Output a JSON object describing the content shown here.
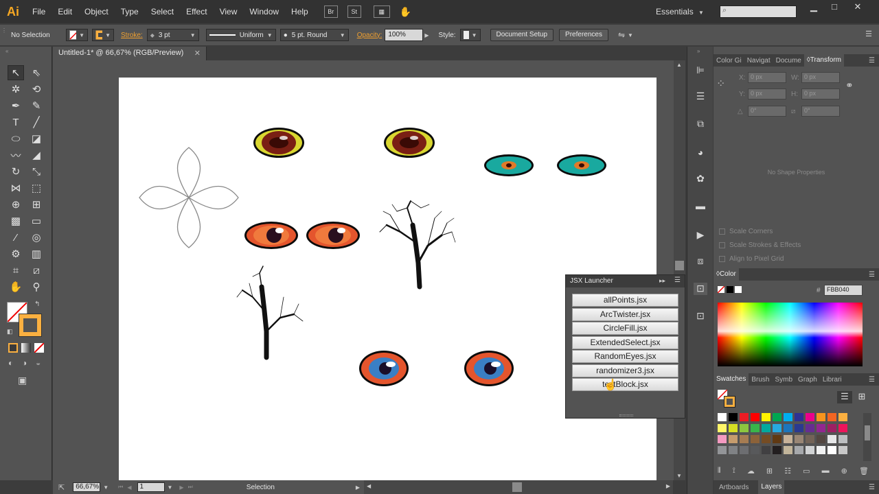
{
  "app": {
    "logo": "Ai"
  },
  "menu": [
    "File",
    "Edit",
    "Object",
    "Type",
    "Select",
    "Effect",
    "View",
    "Window",
    "Help"
  ],
  "menu_buttons": [
    "Br",
    "St"
  ],
  "workspace": "Essentials",
  "control_bar": {
    "selection": "No Selection",
    "stroke_label": "Stroke:",
    "stroke_weight": "3 pt",
    "profile": "Uniform",
    "brush": "5 pt. Round",
    "opacity_label": "Opacity:",
    "opacity": "100%",
    "style_label": "Style:",
    "document_setup": "Document Setup",
    "preferences": "Preferences"
  },
  "document": {
    "tab_title": "Untitled-1* @ 66,67% (RGB/Preview)"
  },
  "status_bar": {
    "zoom": "66,67%",
    "artboard": "1",
    "tool": "Selection"
  },
  "panels": {
    "top_tabs": [
      "Color Gi",
      "Navigat",
      "Docume",
      "Transform"
    ],
    "transform": {
      "x_label": "X:",
      "x": "0 px",
      "w_label": "W:",
      "w": "0 px",
      "y_label": "Y:",
      "y": "0 px",
      "h_label": "H:",
      "h": "0 px",
      "angle": "0°",
      "shear": "0°",
      "no_shape": "No Shape Properties",
      "scale_corners": "Scale Corners",
      "scale_strokes": "Scale Strokes & Effects",
      "align_pixel": "Align to Pixel Grid"
    },
    "color": {
      "title": "Color",
      "hex_label": "#",
      "hex": "FBB040"
    },
    "swatch_tabs": [
      "Swatches",
      "Brush",
      "Symb",
      "Graph",
      "Librari"
    ],
    "bottom_tabs": [
      "Artboards",
      "Layers"
    ]
  },
  "jsx_launcher": {
    "title": "JSX Launcher",
    "scripts": [
      "allPoints.jsx",
      "ArcTwister.jsx",
      "CircleFill.jsx",
      "ExtendedSelect.jsx",
      "RandomEyes.jsx",
      "randomizer3.jsx",
      "textBlock.jsx"
    ]
  },
  "colors": {
    "accent": "#f7a823",
    "fill": "#fbb040",
    "swatches": [
      "#ffffff",
      "#000000",
      "#ed1c24",
      "#ff0000",
      "#fff200",
      "#00a651",
      "#00aeef",
      "#2e3192",
      "#ec008c",
      "#f7941d",
      "#f26522",
      "#fbb040",
      "#fff568",
      "#d7df23",
      "#8dc63f",
      "#39b54a",
      "#00a99d",
      "#27aae1",
      "#1c75bc",
      "#2b3990",
      "#662d91",
      "#92278f",
      "#9e1f63",
      "#ed145b",
      "#f49ac1",
      "#c69c6d",
      "#a67c52",
      "#8c6239",
      "#754c24",
      "#603913",
      "#c7b299",
      "#998675",
      "#736357",
      "#534741",
      "#e6e7e8",
      "#bcbec0",
      "#939598",
      "#808285",
      "#6d6e71",
      "#58595b",
      "#414042",
      "#231f20",
      "#c2b59b",
      "#a7a9ac",
      "#d1d3d4",
      "#f1f2f2",
      "#ffffff",
      "#c8c8c8"
    ]
  }
}
